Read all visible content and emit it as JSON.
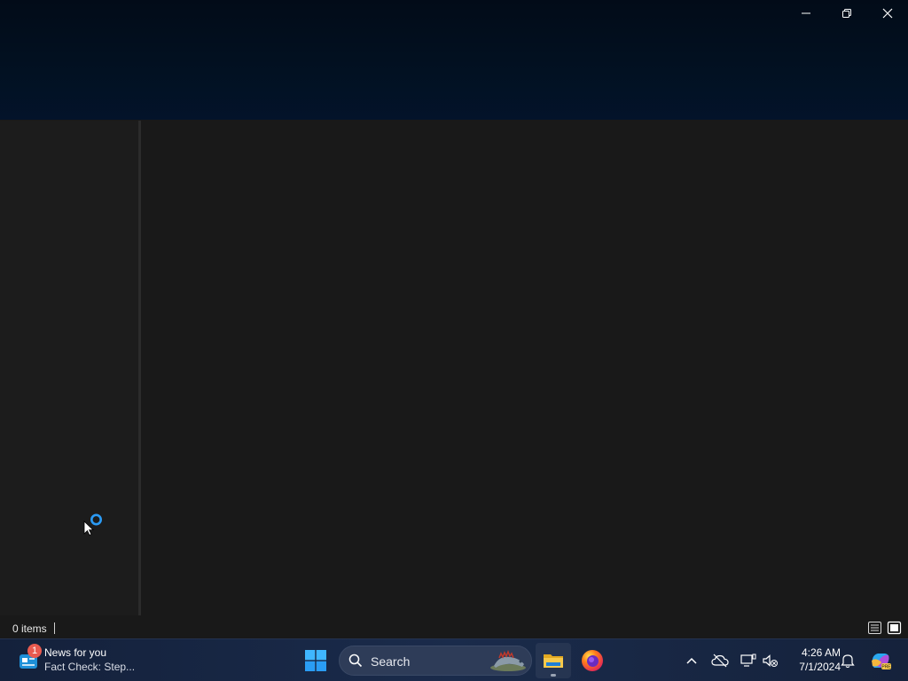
{
  "window": {
    "controls": {
      "minimize_icon": "minimize-icon",
      "restore_icon": "restore-icon",
      "close_icon": "close-icon"
    },
    "status_bar": {
      "item_count": "0 items",
      "details_view_icon": "details-view-icon",
      "tiles_view_icon": "large-icons-view-icon"
    }
  },
  "taskbar": {
    "widget": {
      "badge": "1",
      "title": "News for you",
      "subtitle": "Fact Check: Step..."
    },
    "search": {
      "placeholder": "Search"
    },
    "apps": [
      {
        "name": "File Explorer",
        "icon": "folder-icon",
        "active": true
      },
      {
        "name": "Firefox",
        "icon": "firefox-icon",
        "active": false
      }
    ],
    "tray": {
      "show_hidden_icon": "chevron-up-icon",
      "onedrive_icon": "cloud-icon",
      "display_icon": "display-icon",
      "audio_icon": "speaker-muted-icon",
      "notification_icon": "bell-icon",
      "copilot_icon": "copilot-icon"
    },
    "clock": {
      "time": "4:26 AM",
      "date": "7/1/2024"
    }
  },
  "colors": {
    "titlebar": "#021122",
    "window_bg": "#191919",
    "taskbar": "#1a2b4b",
    "accent": "#2b9bf5"
  }
}
